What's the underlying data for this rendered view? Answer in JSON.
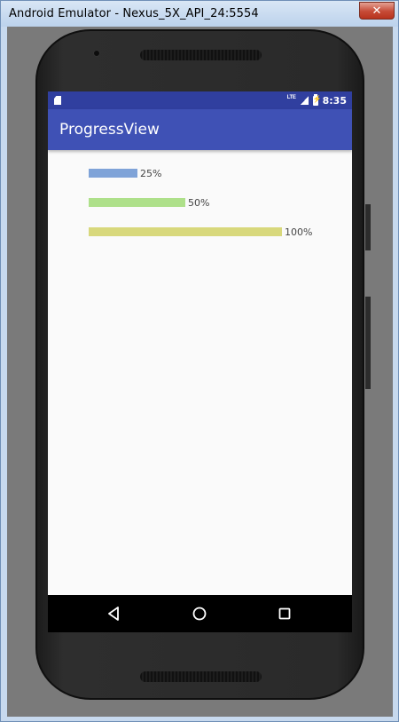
{
  "window": {
    "title": "Android Emulator - Nexus_5X_API_24:5554",
    "close_label": "✕"
  },
  "statusbar": {
    "network": "LTE",
    "time": "8:35"
  },
  "appbar": {
    "title": "ProgressView"
  },
  "progress": [
    {
      "value": 0.25,
      "label": "25%",
      "color": "#7fa3d8"
    },
    {
      "value": 0.5,
      "label": "50%",
      "color": "#aee08a"
    },
    {
      "value": 1.0,
      "label": "100%",
      "color": "#d8d87c"
    }
  ],
  "colors": {
    "statusbar": "#303f9f",
    "appbar": "#3f51b5",
    "screen_bg": "#fafafa",
    "navbar": "#000000"
  },
  "navbar": {
    "icons": [
      "back-icon",
      "home-icon",
      "recents-icon"
    ]
  }
}
